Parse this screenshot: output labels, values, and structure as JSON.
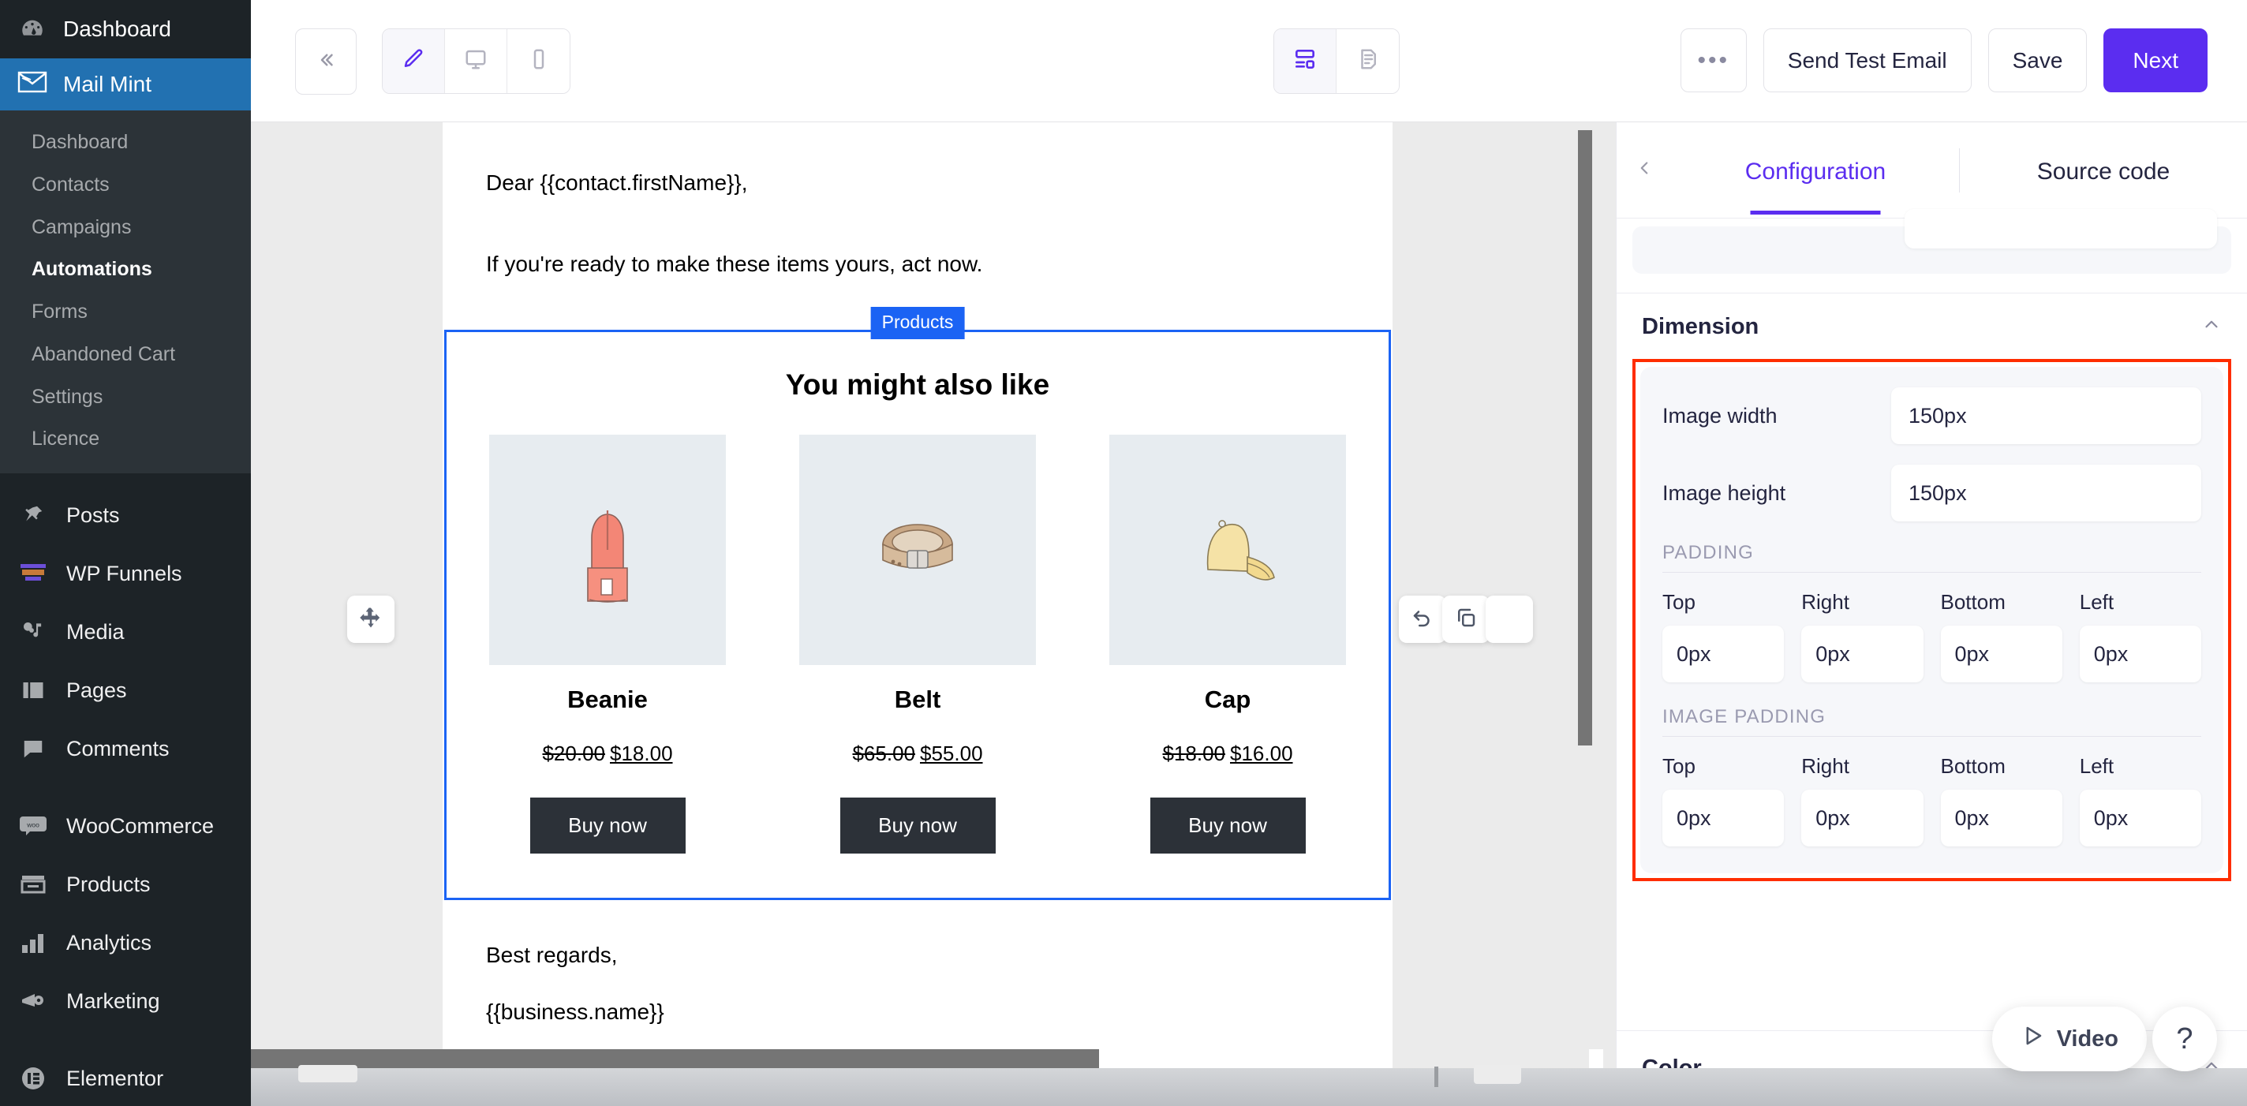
{
  "sidebar": {
    "top_item": {
      "label": "Dashboard",
      "icon": "dashboard-icon"
    },
    "brand": {
      "label": "Mail Mint",
      "icon": "mail-envelope-icon",
      "color": "#2271b1"
    },
    "submenu": [
      {
        "label": "Dashboard",
        "active": false
      },
      {
        "label": "Contacts",
        "active": false
      },
      {
        "label": "Campaigns",
        "active": false
      },
      {
        "label": "Automations",
        "active": true
      },
      {
        "label": "Forms",
        "active": false
      },
      {
        "label": "Abandoned Cart",
        "active": false
      },
      {
        "label": "Settings",
        "active": false
      },
      {
        "label": "Licence",
        "active": false
      }
    ],
    "items": [
      {
        "label": "Posts",
        "icon": "pin-icon"
      },
      {
        "label": "WP Funnels",
        "icon": "funnel-icon"
      },
      {
        "label": "Media",
        "icon": "media-icon"
      },
      {
        "label": "Pages",
        "icon": "pages-icon"
      },
      {
        "label": "Comments",
        "icon": "comment-icon"
      }
    ],
    "items2": [
      {
        "label": "WooCommerce",
        "icon": "woo-icon"
      },
      {
        "label": "Products",
        "icon": "products-icon"
      },
      {
        "label": "Analytics",
        "icon": "analytics-bar-icon"
      },
      {
        "label": "Marketing",
        "icon": "megaphone-icon"
      }
    ],
    "items3": [
      {
        "label": "Elementor",
        "icon": "elementor-icon"
      }
    ]
  },
  "toolbar": {
    "collapse_icon": "chevron-double-left-icon",
    "device_modes": [
      {
        "icon": "pencil-icon",
        "name": "edit-mode",
        "selected": true
      },
      {
        "icon": "desktop-icon",
        "name": "desktop-preview",
        "selected": false
      },
      {
        "icon": "mobile-icon",
        "name": "mobile-preview",
        "selected": false
      }
    ],
    "view_modes": [
      {
        "icon": "layout-blocks-icon",
        "name": "visual-builder",
        "selected": true
      },
      {
        "icon": "document-code-icon",
        "name": "source-view",
        "selected": false
      }
    ],
    "more_label": "•••",
    "send_test_label": "Send Test Email",
    "save_label": "Save",
    "next_label": "Next",
    "accent_color": "#5b2df0"
  },
  "email": {
    "greeting": "Dear {{contact.firstName}},",
    "intro": "If you're ready to make these items yours, act now.",
    "block_tag": "Products",
    "block_tag_color": "#1b63f4",
    "products_title": "You might also like",
    "products": [
      {
        "name": "Beanie",
        "old_price": "$20.00",
        "new_price": "$18.00",
        "cta": "Buy now",
        "image": "beanie-illustration"
      },
      {
        "name": "Belt",
        "old_price": "$65.00",
        "new_price": "$55.00",
        "cta": "Buy now",
        "image": "belt-illustration"
      },
      {
        "name": "Cap",
        "old_price": "$18.00",
        "new_price": "$16.00",
        "cta": "Buy now",
        "image": "cap-illustration"
      }
    ],
    "signoff": "Best regards,",
    "business": "{{business.name}}",
    "tools": {
      "move_icon": "move-arrows-icon",
      "undo_icon": "undo-arrow-icon",
      "duplicate_icon": "copy-duplicate-icon"
    }
  },
  "panel": {
    "back_icon": "chevron-left-icon",
    "tabs": [
      {
        "label": "Configuration",
        "active": true
      },
      {
        "label": "Source code",
        "active": false
      }
    ],
    "dimension": {
      "title": "Dimension",
      "collapse_icon": "chevron-up-icon",
      "highlight_color": "#ff2d00",
      "fields": [
        {
          "label": "Image width",
          "value": "150px"
        },
        {
          "label": "Image height",
          "value": "150px"
        }
      ],
      "padding": {
        "heading": "PADDING",
        "cells": [
          {
            "label": "Top",
            "value": "0px"
          },
          {
            "label": "Right",
            "value": "0px"
          },
          {
            "label": "Bottom",
            "value": "0px"
          },
          {
            "label": "Left",
            "value": "0px"
          }
        ]
      },
      "image_padding": {
        "heading": "IMAGE PADDING",
        "cells": [
          {
            "label": "Top",
            "value": "0px"
          },
          {
            "label": "Right",
            "value": "0px"
          },
          {
            "label": "Bottom",
            "value": "0px"
          },
          {
            "label": "Left",
            "value": "0px"
          }
        ]
      }
    },
    "color_section": {
      "title": "Color",
      "collapse_icon": "chevron-up-icon"
    }
  },
  "fabs": {
    "video_label": "Video",
    "video_icon": "play-triangle-icon",
    "help_label": "?"
  }
}
